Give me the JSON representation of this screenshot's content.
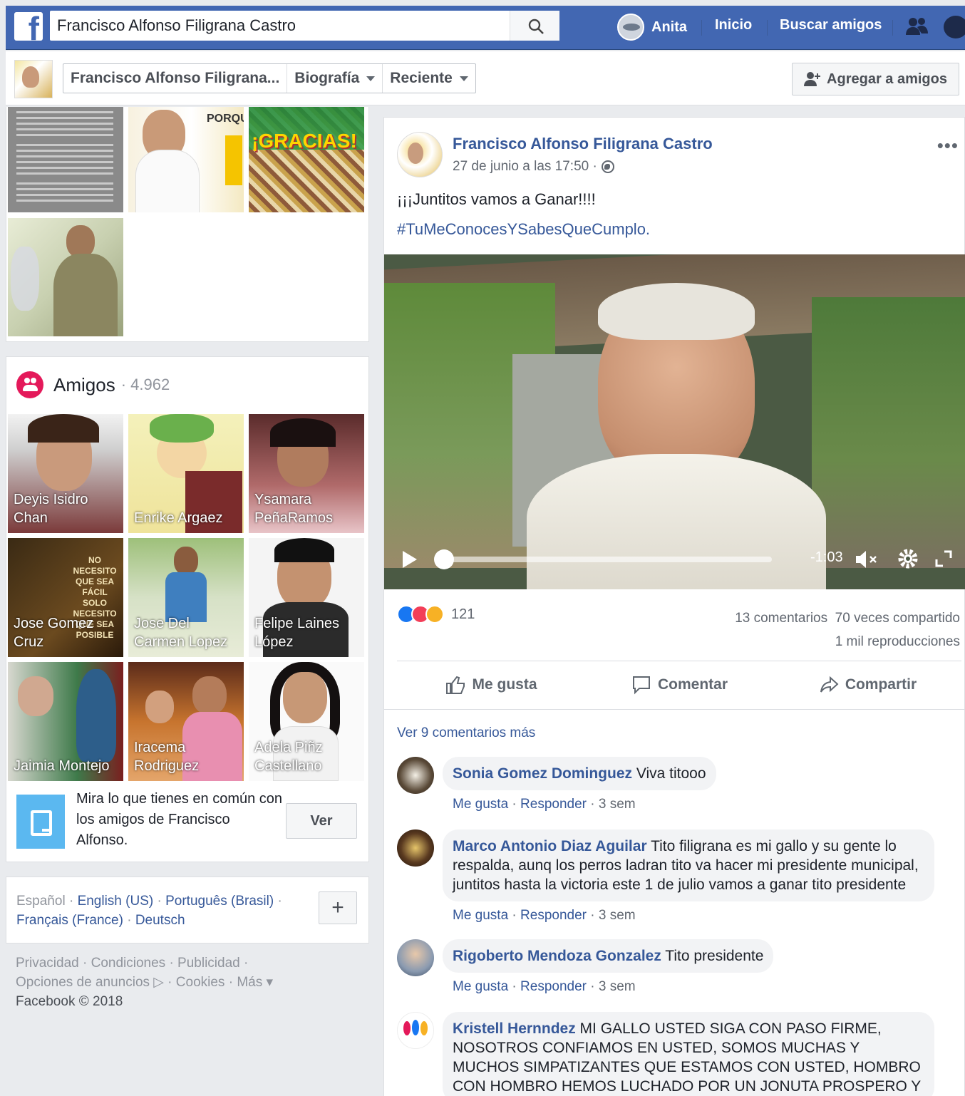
{
  "topbar": {
    "logo": "f",
    "search_value": "Francisco Alfonso Filigrana Castro",
    "search_icon": "search-icon",
    "user_name": "Anita",
    "nav_home": "Inicio",
    "nav_find_friends": "Buscar amigos",
    "friends_icon": "friend-requests-icon",
    "messenger_icon": "messenger-icon"
  },
  "subhead": {
    "profile_name": "Francisco Alfonso Filigrana...",
    "tab_bio": "Biografía",
    "tab_recent": "Reciente",
    "add_friend": "Agregar a amigos"
  },
  "photos": {
    "tile2_text": "PORQUE",
    "tile3_text": "¡GRACIAS!"
  },
  "friends": {
    "title": "Amigos",
    "count": "· 4.962",
    "items": [
      {
        "name": "Deyis Isidro Chan"
      },
      {
        "name": "Enrike Argaez"
      },
      {
        "name": "Ysamara PeñaRamos"
      },
      {
        "name": "Jose Gomez Cruz"
      },
      {
        "name": "Jose Del Carmen Lopez"
      },
      {
        "name": "Felipe Laines López"
      },
      {
        "name": "Jaimia Montejo"
      },
      {
        "name": "Iracema Rodriguez"
      },
      {
        "name": "Adela Piñz Castellano"
      }
    ],
    "lion_text": "NO NECESITO QUE SEA FÁCIL SOLO NECESITO QUE SEA POSIBLE",
    "common_text": "Mira lo que tienes en común con los amigos de Francisco Alfonso.",
    "common_button": "Ver"
  },
  "languages": {
    "current": "Español",
    "sep": " · ",
    "l1": "English (US)",
    "l2": "Português (Brasil)",
    "l3": "Français (France)",
    "l4": "Deutsch",
    "plus": "+"
  },
  "footer": {
    "line1": "Privacidad · Condiciones · Publicidad ·",
    "line2": "Opciones de anuncios ▷ · Cookies · Más ▾",
    "line3": "Facebook © 2018"
  },
  "post": {
    "author": "Francisco Alfonso Filigrana Castro",
    "time": "27 de junio a las 17:50 ·",
    "more": "•••",
    "text": "¡¡¡Juntitos vamos a Ganar!!!!",
    "hashtag": "#TuMeConocesYSabesQueCumplo.",
    "video_time": "-1:03",
    "reaction_count": "121",
    "comments_count": "13 comentarios",
    "shares_count": "70 veces compartido",
    "views": "1 mil reproducciones",
    "like": "Me gusta",
    "comment": "Comentar",
    "share": "Compartir",
    "view_more": "Ver 9 comentarios más"
  },
  "comments": [
    {
      "name": "Sonia Gomez Dominguez",
      "text": " Viva titooo",
      "like": "Me gusta",
      "reply": "Responder",
      "time": " · 3 sem"
    },
    {
      "name": "Marco Antonio Diaz Aguilar",
      "text": " Tito filigrana es mi gallo y su gente lo respalda, aunq los perros ladran tito va hacer mi presidente municipal, juntitos hasta la victoria este 1 de julio vamos a ganar tito presidente",
      "like": "Me gusta",
      "reply": "Responder",
      "time": " · 3 sem"
    },
    {
      "name": "Rigoberto Mendoza Gonzalez",
      "text": " Tito presidente",
      "like": "Me gusta",
      "reply": "Responder",
      "time": " · 3 sem"
    },
    {
      "name": "Kristell Hernndez",
      "text": " MI GALLO USTED SIGA CON PASO FIRME, NOSOTROS CONFIAMOS EN USTED, SOMOS MUCHAS Y MUCHOS SIMPATIZANTES QUE ESTAMOS CON USTED, HOMBRO CON HOMBRO HEMOS LUCHADO POR UN JONUTA PROSPERO Y"
    }
  ],
  "colors": {
    "brand": "#4267b2",
    "link": "#365899",
    "background": "#e9ebee",
    "friends_icon": "#e4195a"
  }
}
